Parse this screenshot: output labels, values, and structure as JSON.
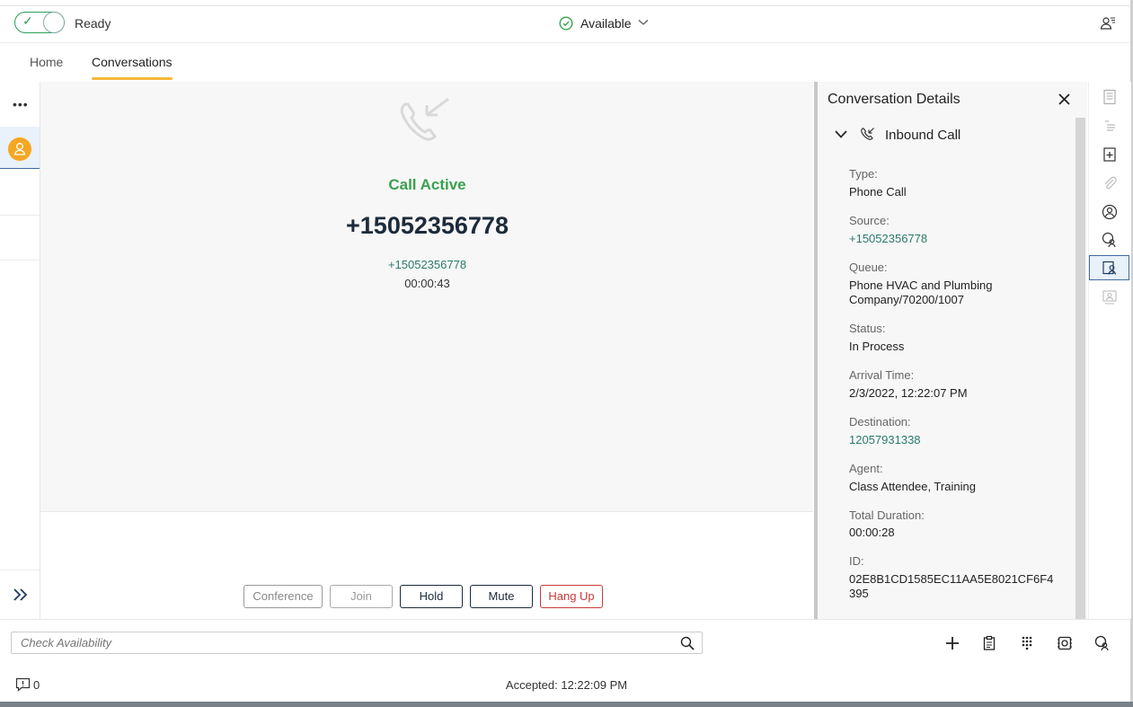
{
  "status": {
    "ready_label": "Ready",
    "availability": "Available"
  },
  "tabs": {
    "home": "Home",
    "conversations": "Conversations"
  },
  "rail": {
    "more": "•••"
  },
  "call": {
    "state": "Call Active",
    "number": "+15052356778",
    "sub_number": "+15052356778",
    "timer": "00:00:43"
  },
  "controls": {
    "conference": "Conference",
    "join": "Join",
    "hold": "Hold",
    "mute": "Mute",
    "hangup": "Hang Up"
  },
  "details": {
    "title": "Conversation Details",
    "section": "Inbound Call",
    "fields": {
      "type_label": "Type:",
      "type_value": "Phone Call",
      "source_label": "Source:",
      "source_value": "+15052356778",
      "queue_label": "Queue:",
      "queue_value": "Phone HVAC and Plumbing Company/70200/1007",
      "status_label": "Status:",
      "status_value": "In Process",
      "arrival_label": "Arrival Time:",
      "arrival_value": "2/3/2022, 12:22:07 PM",
      "destination_label": "Destination:",
      "destination_value": "12057931338",
      "agent_label": "Agent:",
      "agent_value": "Class Attendee, Training",
      "duration_label": "Total Duration:",
      "duration_value": "00:00:28",
      "id_label": "ID:",
      "id_value": "02E8B1CD1585EC11AA5E8021CF6F4395"
    }
  },
  "bottom": {
    "search_placeholder": "Check Availability",
    "notification_count": "0",
    "accepted": "Accepted: 12:22:09 PM"
  },
  "colors": {
    "accent": "#f5b73a",
    "success": "#3aa14f",
    "link": "#2a7a6a",
    "danger": "#c83a3a",
    "navy": "#1c2b3a"
  }
}
